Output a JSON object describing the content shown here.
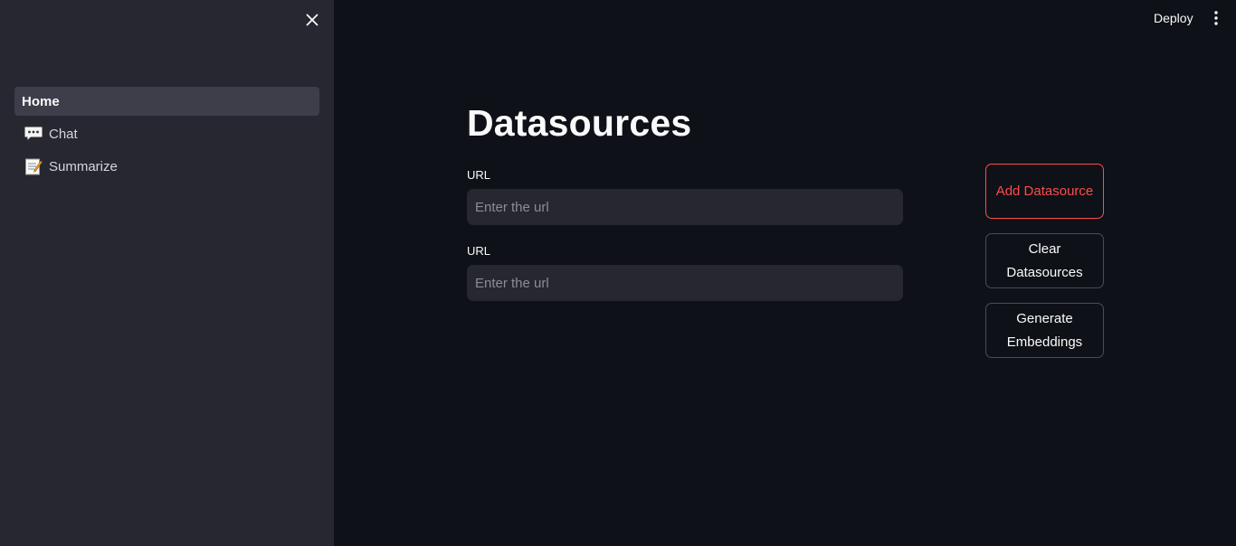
{
  "sidebar": {
    "close_icon": "close-icon",
    "items": [
      {
        "label": "Home",
        "emoji": "",
        "active": true
      },
      {
        "label": "Chat",
        "emoji": "speech-bubble-icon",
        "active": false
      },
      {
        "label": "Summarize",
        "emoji": "memo-icon",
        "active": false
      }
    ]
  },
  "header": {
    "deploy_label": "Deploy",
    "menu_icon": "kebab-menu-icon"
  },
  "main": {
    "title": "Datasources",
    "fields": [
      {
        "label": "URL",
        "placeholder": "Enter the url",
        "value": ""
      },
      {
        "label": "URL",
        "placeholder": "Enter the url",
        "value": ""
      }
    ],
    "buttons": {
      "add": "Add Datasource",
      "clear": "Clear Datasources",
      "generate": "Generate Embeddings"
    }
  },
  "colors": {
    "background": "#0e1117",
    "sidebar": "#262730",
    "accent": "#ff4b4b"
  }
}
